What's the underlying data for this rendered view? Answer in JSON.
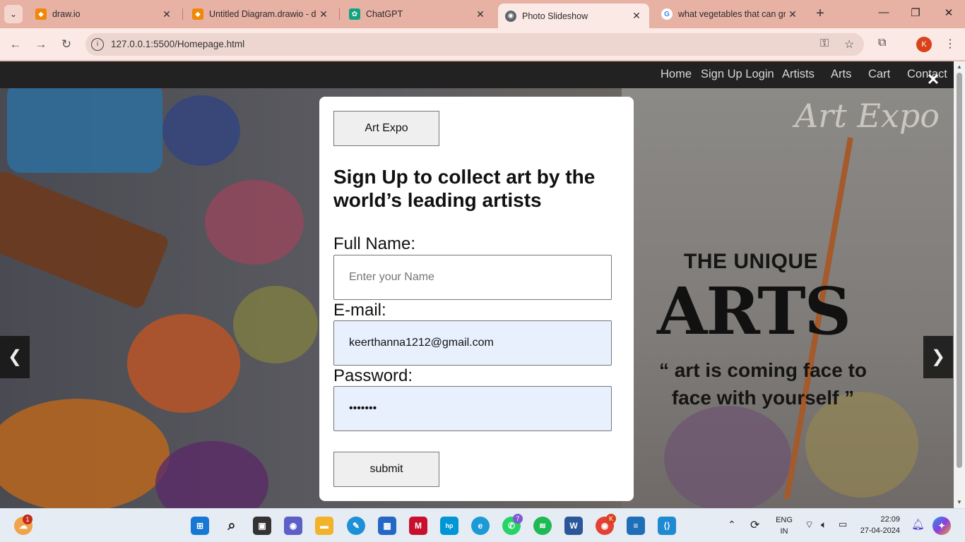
{
  "browser": {
    "tabs": [
      {
        "title": "draw.io",
        "favicon": "drawio-icon",
        "color": "#f08705",
        "active": false
      },
      {
        "title": "Untitled Diagram.drawio - d",
        "favicon": "drawio-file-icon",
        "color": "#f08705",
        "active": false
      },
      {
        "title": "ChatGPT",
        "favicon": "chatgpt-icon",
        "color": "#10a37f",
        "active": false
      },
      {
        "title": "Photo Slideshow",
        "favicon": "globe-icon",
        "color": "#5f6368",
        "active": true
      },
      {
        "title": "what vegetables that can gr",
        "favicon": "google-icon",
        "color": "#4285f4",
        "active": false
      }
    ],
    "url": "127.0.0.1:5500/Homepage.html",
    "profile_initial": "K"
  },
  "site": {
    "nav": [
      "Home",
      "Sign Up Login",
      "Artists",
      "Arts",
      "Cart",
      "Contact"
    ],
    "hero": {
      "brand_script": "Art Expo",
      "line1": "THE UNIQUE",
      "line2": "ARTS",
      "quote": "“ art is coming  face to face with yourself ”"
    },
    "slider": {
      "prev": "❮",
      "next": "❯"
    }
  },
  "modal": {
    "close": "✕",
    "brand_button": "Art Expo",
    "heading": "Sign Up to collect art by the world’s leading artists",
    "fields": {
      "name": {
        "label": "Full Name:",
        "placeholder": "Enter your Name",
        "value": ""
      },
      "email": {
        "label": "E-mail:",
        "value": "keerthanna1212@gmail.com"
      },
      "password": {
        "label": "Password:",
        "value": "1234567"
      }
    },
    "submit": "submit"
  },
  "taskbar": {
    "weather_badge": "1",
    "whatsapp_badge": "7",
    "chrome_profile_badge": "K",
    "lang_top": "ENG",
    "lang_bottom": "IN",
    "time": "22:09",
    "date": "27-04-2024"
  }
}
